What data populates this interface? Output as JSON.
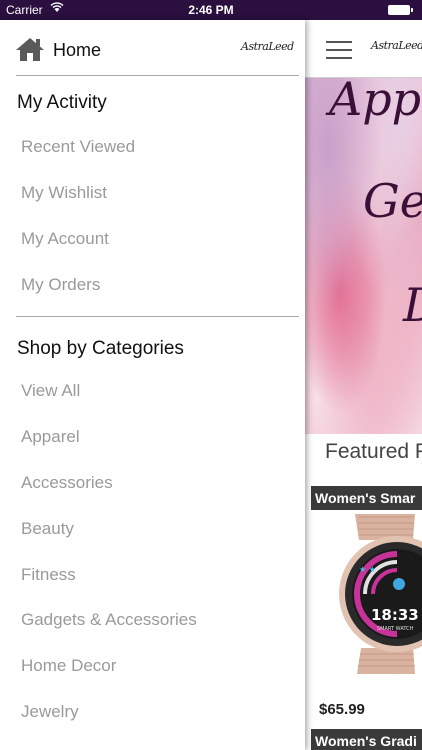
{
  "status_bar": {
    "carrier": "Carrier",
    "time": "2:46 PM"
  },
  "drawer": {
    "home_label": "Home",
    "logo_text": "AstraLeed",
    "activity_title": "My Activity",
    "activity_items": [
      "Recent Viewed",
      "My Wishlist",
      "My Account",
      "My Orders"
    ],
    "categories_title": "Shop by Categories",
    "category_items": [
      "View All",
      "Apparel",
      "Accessories",
      "Beauty",
      "Fitness",
      "Gadgets & Accessories",
      "Home Decor",
      "Jewelry"
    ]
  },
  "content": {
    "logo_text": "AstraLeed",
    "banner_lines": [
      "App",
      "Ge",
      "D"
    ],
    "featured_title": "Featured P",
    "product_1": {
      "name": "Women's Smar",
      "price": "$65.99",
      "watch_time": "18:33",
      "watch_brand": "SMART WATCH"
    },
    "product_2": {
      "name": "Women's Gradi"
    }
  },
  "colors": {
    "status_bar_bg": "#2a0f3f",
    "tag_bg": "#3a3a3a",
    "menu_item_text": "#9a9a9a"
  }
}
